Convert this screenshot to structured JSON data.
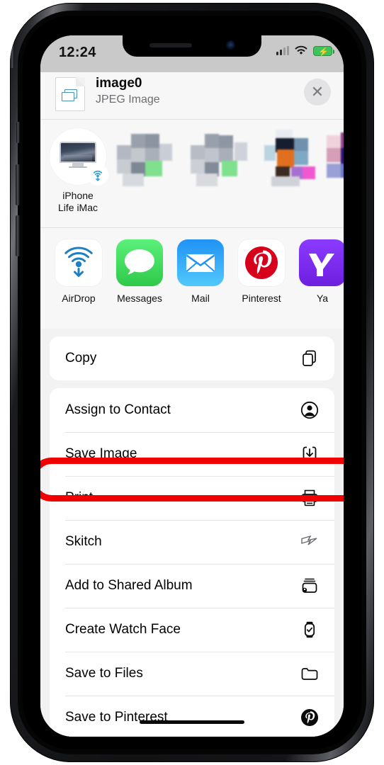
{
  "status_bar": {
    "time": "12:24",
    "cellular_icon": "cellular-bars-icon",
    "wifi_icon": "wifi-icon",
    "battery_icon": "battery-charging-icon"
  },
  "share_sheet": {
    "header": {
      "title": "image0",
      "subtitle": "JPEG Image",
      "file_icon": "jpeg-document-icon",
      "close_label": "✕"
    },
    "airdrop": {
      "device_name_line1": "iPhone",
      "device_name_line2": "Life iMac",
      "badge_icon": "airdrop-icon"
    },
    "apps": [
      {
        "label": "AirDrop",
        "icon": "airdrop-icon",
        "color": "#ffffff"
      },
      {
        "label": "Messages",
        "icon": "messages-icon",
        "color": "#4cd663"
      },
      {
        "label": "Mail",
        "icon": "mail-icon",
        "color": "#1d9bf5"
      },
      {
        "label": "Pinterest",
        "icon": "pinterest-icon",
        "color": "#ffffff"
      },
      {
        "label": "Ya",
        "icon": "yahoo-icon",
        "color": "#7b2ff7"
      }
    ],
    "actions_group_1": [
      {
        "label": "Copy",
        "icon": "copy-icon"
      }
    ],
    "actions_group_2": [
      {
        "label": "Assign to Contact",
        "icon": "person-circle-icon",
        "highlighted": false
      },
      {
        "label": "Save Image",
        "icon": "save-download-icon",
        "highlighted": true
      },
      {
        "label": "Print",
        "icon": "printer-icon",
        "highlighted": false
      },
      {
        "label": "Skitch",
        "icon": "skitch-arrow-icon",
        "highlighted": false
      },
      {
        "label": "Add to Shared Album",
        "icon": "shared-album-icon",
        "highlighted": false
      },
      {
        "label": "Create Watch Face",
        "icon": "apple-watch-icon",
        "highlighted": false
      },
      {
        "label": "Save to Files",
        "icon": "folder-icon",
        "highlighted": false
      },
      {
        "label": "Save to Pinterest",
        "icon": "pinterest-icon",
        "highlighted": false
      }
    ]
  },
  "annotation": {
    "target_label": "Save Image",
    "color": "#f00000",
    "shape": "oval-outline"
  },
  "device": {
    "home_indicator": "home-indicator",
    "buttons": [
      "mute-switch",
      "volume-up",
      "volume-down",
      "power"
    ]
  }
}
